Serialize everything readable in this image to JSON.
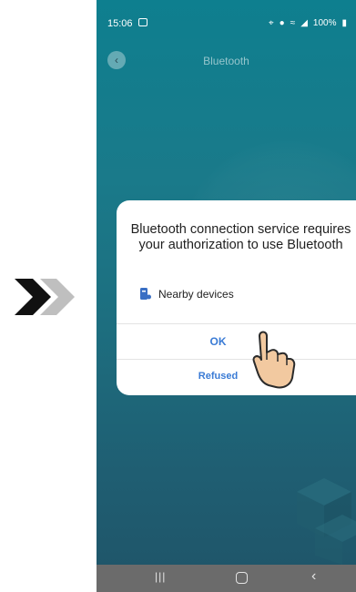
{
  "status_bar": {
    "time": "15:06",
    "battery": "100%"
  },
  "app_bar": {
    "title": "Bluetooth"
  },
  "dialog": {
    "title": "Bluetooth connection service requires your authorization to use Bluetooth",
    "permission_label": "Nearby devices",
    "ok_label": "OK",
    "refuse_label": "Refused"
  },
  "colors": {
    "teal_bg": "#1a7a8a",
    "button_blue": "#3a7bd5",
    "nav_gray": "#6b6b6b"
  }
}
